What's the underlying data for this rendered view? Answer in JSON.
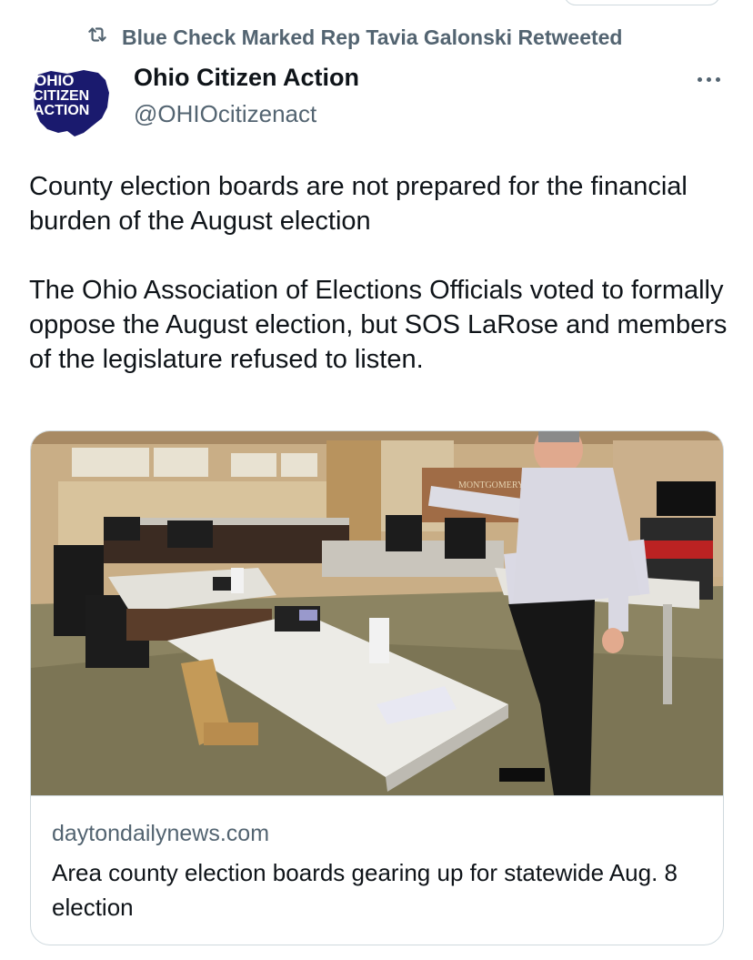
{
  "retweet": {
    "icon": "retweet-icon",
    "text": "Blue Check Marked Rep Tavia Galonski Retweeted"
  },
  "author": {
    "avatar_text": [
      "OHIO",
      "CITIZEN",
      "ACTION"
    ],
    "name": "Ohio Citizen Action",
    "handle": "@OHIOcitizenact"
  },
  "tweet": {
    "paragraph1": "County election boards are not prepared for the financial burden of the August election",
    "paragraph2": "The Ohio Association of Elections Officials voted to formally oppose the August election, but SOS LaRose and members of the legislature refused to listen."
  },
  "card": {
    "domain": "daytondailynews.com",
    "title": "Area county election boards gearing up for statewide Aug. 8 election"
  },
  "colors": {
    "text_primary": "#0f1419",
    "text_secondary": "#536471",
    "border": "#cfd9de",
    "avatar_blue": "#1a1a6e"
  }
}
